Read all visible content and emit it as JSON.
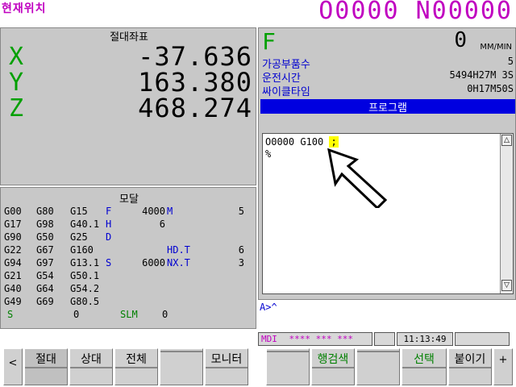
{
  "header": {
    "screen_title": "현재위치",
    "program_ids": "O0000 N00000"
  },
  "absolute": {
    "title": "절대좌표",
    "axes": [
      {
        "label": "X",
        "value": "-37.636"
      },
      {
        "label": "Y",
        "value": "163.380"
      },
      {
        "label": "Z",
        "value": "468.274"
      }
    ]
  },
  "modal": {
    "title": "모달",
    "rows": [
      [
        "G00",
        "G80",
        "G15",
        "F",
        "4000",
        "M",
        "5"
      ],
      [
        "G17",
        "G98",
        "G40.1",
        "H",
        "6",
        "",
        ""
      ],
      [
        "G90",
        "G50",
        "G25",
        "D",
        "",
        "",
        ""
      ],
      [
        "G22",
        "G67",
        "G160",
        "",
        "",
        "HD.T",
        "6"
      ],
      [
        "G94",
        "G97",
        "G13.1",
        "S",
        "6000",
        "NX.T",
        "3"
      ],
      [
        "G21",
        "G54",
        "G50.1",
        "",
        "",
        "",
        ""
      ],
      [
        "G40",
        "G64",
        "G54.2",
        "",
        "",
        "",
        ""
      ],
      [
        "G49",
        "G69",
        "G80.5",
        "",
        "",
        "",
        ""
      ]
    ],
    "last_row": {
      "s_label": "S",
      "s_val": "0",
      "slm_label": "SLM",
      "slm_val": "0"
    }
  },
  "feed": {
    "letter": "F",
    "value": "0",
    "unit": "MM/MIN"
  },
  "info": [
    {
      "label": "가공부품수",
      "value": "5"
    },
    {
      "label": "운전시간",
      "value": "5494H27M 3S"
    },
    {
      "label": "싸이클타임",
      "value": "0H17M50S"
    }
  ],
  "program": {
    "header": "프로그램",
    "line1_text": "O0000 G100 ",
    "line1_cursor": ";",
    "line2": "%",
    "scroll_up": "△",
    "scroll_down": "▽"
  },
  "input_line": "A>^",
  "status": {
    "mode": "MDI",
    "stars": "**** *** ***",
    "blank": "",
    "time": "11:13:49"
  },
  "softkeys_left": {
    "prev": "<",
    "k1": "절대",
    "k2": "상대",
    "k3": "전체",
    "k4": "",
    "k5": "모니터"
  },
  "softkeys_right": {
    "k1": "",
    "k2": "행검색",
    "k3": "",
    "k4": "선택",
    "k5": "붙이기",
    "next": "+"
  },
  "colors": {
    "magenta": "#c000c0",
    "axis_green": "#00a000",
    "panel_gray": "#c8c8c8",
    "header_blue": "#0000e0"
  }
}
